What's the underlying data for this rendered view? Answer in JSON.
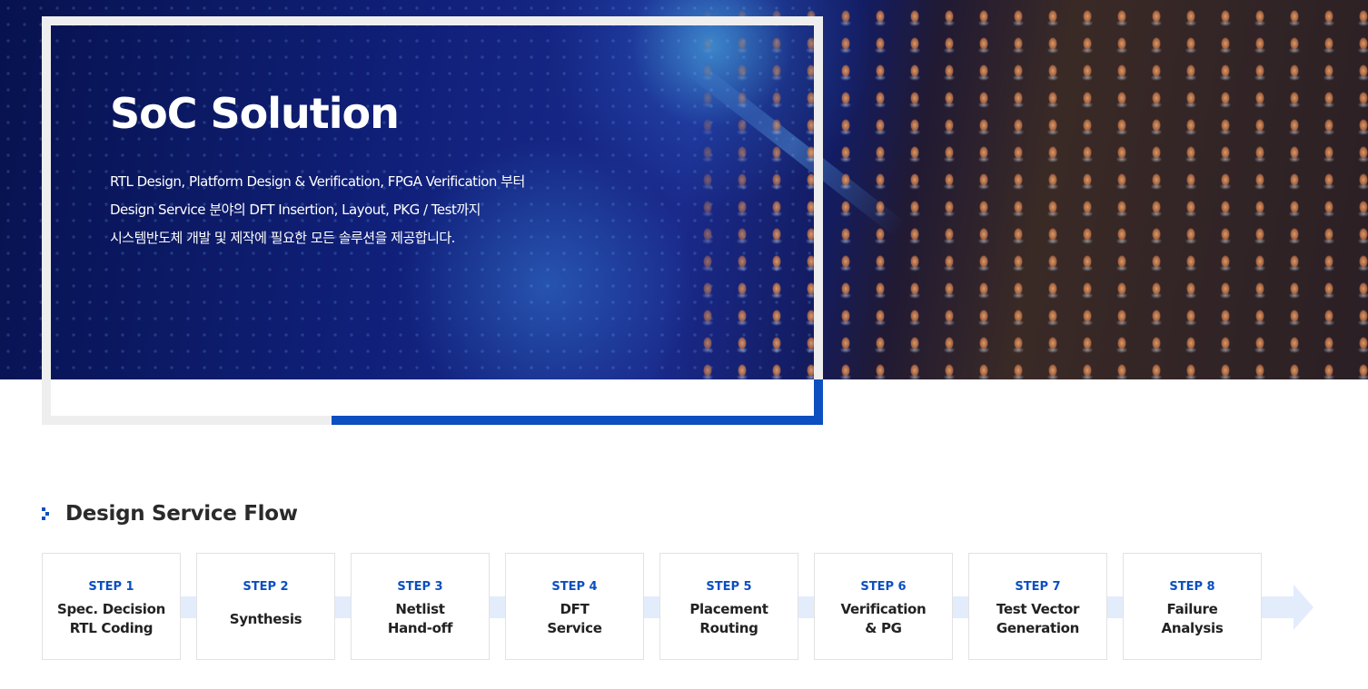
{
  "hero": {
    "title": "SoC Solution",
    "description_lines": [
      "RTL Design, Platform Design & Verification, FPGA Verification 부터",
      "Design Service 분야의 DFT Insertion, Layout, PKG / Test까지",
      "시스템반도체 개발 및 제작에 필요한 모든 솔루션을 제공합니다."
    ]
  },
  "section": {
    "title": "Design Service Flow"
  },
  "flow": {
    "steps": [
      {
        "label": "STEP 1",
        "name": "Spec. Decision\nRTL Coding"
      },
      {
        "label": "STEP 2",
        "name": "Synthesis"
      },
      {
        "label": "STEP 3",
        "name": "Netlist\nHand-off"
      },
      {
        "label": "STEP 4",
        "name": "DFT\nService"
      },
      {
        "label": "STEP 5",
        "name": "Placement\nRouting"
      },
      {
        "label": "STEP 6",
        "name": "Verification\n& PG"
      },
      {
        "label": "STEP 7",
        "name": "Test Vector\nGeneration"
      },
      {
        "label": "STEP 8",
        "name": "Failure\nAnalysis"
      }
    ]
  },
  "colors": {
    "accent": "#0b4fc0",
    "frame_gray": "#eeeeee",
    "arrow_fill": "#e3ecfb"
  }
}
